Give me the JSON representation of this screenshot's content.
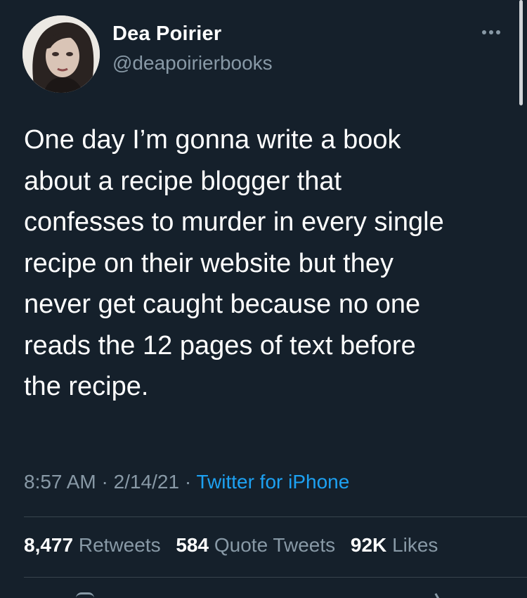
{
  "author": {
    "name": "Dea Poirier",
    "handle": "@deapoirierbooks"
  },
  "tweet": {
    "text": "One day I’m gonna write a book\nabout a recipe blogger that\nconfesses to murder in every single\nrecipe on their website but they\nnever get caught because no one\nreads the 12 pages of text before\nthe recipe."
  },
  "meta": {
    "time": "8:57 AM",
    "sep1": " · ",
    "date": "2/14/21",
    "sep2": " · ",
    "source": "Twitter for iPhone"
  },
  "stats": {
    "retweets_count": "8,477",
    "retweets_label": "Retweets",
    "quotes_count": "584",
    "quotes_label": "Quote Tweets",
    "likes_count": "92K",
    "likes_label": "Likes"
  },
  "icons": {
    "more": "more-horizontal-icon"
  },
  "colors": {
    "background": "#15202b",
    "text_primary": "#ffffff",
    "text_secondary": "#8899a6",
    "link": "#1da1f2",
    "divider": "#38444d"
  }
}
